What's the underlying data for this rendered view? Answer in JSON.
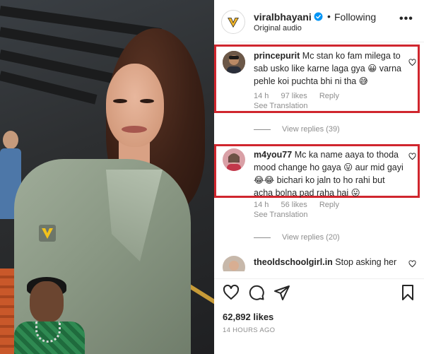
{
  "post": {
    "username": "viralbhayani",
    "separator": "•",
    "follow_status": "Following",
    "audio": "Original audio",
    "more_label": "•••"
  },
  "comments": [
    {
      "username": "princepurit",
      "text": "Mc stan ko fam milega to sab usko like karne laga gya 😀 varna pehle koi puchta bhi ni tha 😅",
      "age": "14 h",
      "likes": "97 likes",
      "reply": "Reply",
      "translation": "See Translation",
      "view_replies": "View replies (39)"
    },
    {
      "username": "m4you77",
      "text": "Mc ka name aaya to thoda mood change ho gaya 😛 aur mid gayi 😂😂 bichari ko jaln to ho rahi but acha bolna pad raha hai 😛",
      "age": "14 h",
      "likes": "56 likes",
      "reply": "Reply",
      "translation": "See Translation",
      "view_replies": "View replies (20)"
    },
    {
      "username": "theoldschoolgirl.in",
      "text": "Stop asking her"
    }
  ],
  "footer": {
    "likes": "62,892 likes",
    "time": "14 HOURS AGO"
  },
  "colors": {
    "highlight": "#d0262e",
    "muted_text": "#8e8e8e",
    "verified": "#0095f6"
  }
}
